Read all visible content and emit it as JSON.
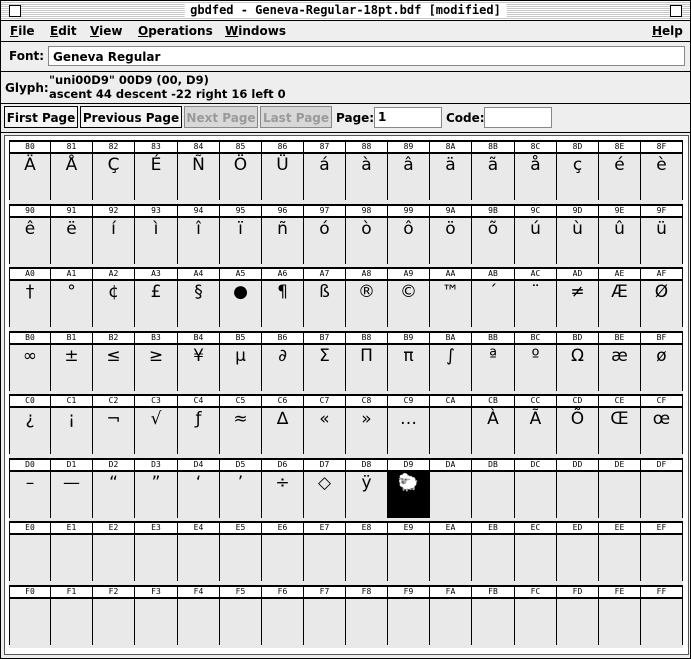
{
  "window": {
    "title": "gbdfed - Geneva-Regular-18pt.bdf [modified]"
  },
  "menubar": {
    "items": [
      "File",
      "Edit",
      "View",
      "Operations",
      "Windows"
    ],
    "help": "Help"
  },
  "font": {
    "label": "Font:",
    "value": "Geneva Regular"
  },
  "glyph": {
    "label": "Glyph:",
    "line1": "\"uni00D9\" 00D9 (00, D9)",
    "line2": "ascent 44 descent -22 right 16 left 0"
  },
  "toolbar": {
    "first_page": "First Page",
    "previous_page": "Previous Page",
    "next_page": "Next Page",
    "last_page": "Last Page",
    "page_label": "Page:",
    "page_value": "1",
    "code_label": "Code:",
    "code_value": ""
  },
  "grid": {
    "selected_code": "D9",
    "rows": [
      {
        "codes": [
          "80",
          "81",
          "82",
          "83",
          "84",
          "85",
          "86",
          "87",
          "88",
          "89",
          "8A",
          "8B",
          "8C",
          "8D",
          "8E",
          "8F"
        ],
        "glyphs": [
          "Ä",
          "Å",
          "Ç",
          "É",
          "Ñ",
          "Ö",
          "Ü",
          "á",
          "à",
          "â",
          "ä",
          "ã",
          "å",
          "ç",
          "é",
          "è"
        ]
      },
      {
        "codes": [
          "90",
          "91",
          "92",
          "93",
          "94",
          "95",
          "96",
          "97",
          "98",
          "99",
          "9A",
          "9B",
          "9C",
          "9D",
          "9E",
          "9F"
        ],
        "glyphs": [
          "ê",
          "ë",
          "í",
          "ì",
          "î",
          "ï",
          "ñ",
          "ó",
          "ò",
          "ô",
          "ö",
          "õ",
          "ú",
          "ù",
          "û",
          "ü"
        ]
      },
      {
        "codes": [
          "A0",
          "A1",
          "A2",
          "A3",
          "A4",
          "A5",
          "A6",
          "A7",
          "A8",
          "A9",
          "AA",
          "AB",
          "AC",
          "AD",
          "AE",
          "AF"
        ],
        "glyphs": [
          "†",
          "°",
          "¢",
          "£",
          "§",
          "●",
          "¶",
          "ß",
          "®",
          "©",
          "™",
          "´",
          "¨",
          "≠",
          "Æ",
          "Ø"
        ]
      },
      {
        "codes": [
          "B0",
          "B1",
          "B2",
          "B3",
          "B4",
          "B5",
          "B6",
          "B7",
          "B8",
          "B9",
          "BA",
          "BB",
          "BC",
          "BD",
          "BE",
          "BF"
        ],
        "glyphs": [
          "∞",
          "±",
          "≤",
          "≥",
          "¥",
          "µ",
          "∂",
          "Σ",
          "Π",
          "π",
          "∫",
          "ª",
          "º",
          "Ω",
          "æ",
          "ø"
        ]
      },
      {
        "codes": [
          "C0",
          "C1",
          "C2",
          "C3",
          "C4",
          "C5",
          "C6",
          "C7",
          "C8",
          "C9",
          "CA",
          "CB",
          "CC",
          "CD",
          "CE",
          "CF"
        ],
        "glyphs": [
          "¿",
          "¡",
          "¬",
          "√",
          "ƒ",
          "≈",
          "∆",
          "«",
          "»",
          "…",
          "",
          "À",
          "Ã",
          "Õ",
          "Œ",
          "œ"
        ]
      },
      {
        "codes": [
          "D0",
          "D1",
          "D2",
          "D3",
          "D4",
          "D5",
          "D6",
          "D7",
          "D8",
          "D9",
          "DA",
          "DB",
          "DC",
          "DD",
          "DE",
          "DF"
        ],
        "glyphs": [
          "–",
          "—",
          "“",
          "”",
          "‘",
          "’",
          "÷",
          "◇",
          "ÿ",
          "🐑",
          "",
          "",
          "",
          "",
          "",
          ""
        ]
      },
      {
        "codes": [
          "E0",
          "E1",
          "E2",
          "E3",
          "E4",
          "E5",
          "E6",
          "E7",
          "E8",
          "E9",
          "EA",
          "EB",
          "EC",
          "ED",
          "EE",
          "EF"
        ],
        "glyphs": [
          "",
          "",
          "",
          "",
          "",
          "",
          "",
          "",
          "",
          "",
          "",
          "",
          "",
          "",
          "",
          ""
        ]
      },
      {
        "codes": [
          "F0",
          "F1",
          "F2",
          "F3",
          "F4",
          "F5",
          "F6",
          "F7",
          "F8",
          "F9",
          "FA",
          "FB",
          "FC",
          "FD",
          "FE",
          "FF"
        ],
        "glyphs": [
          "",
          "",
          "",
          "",
          "",
          "",
          "",
          "",
          "",
          "",
          "",
          "",
          "",
          "",
          "",
          ""
        ]
      }
    ]
  }
}
